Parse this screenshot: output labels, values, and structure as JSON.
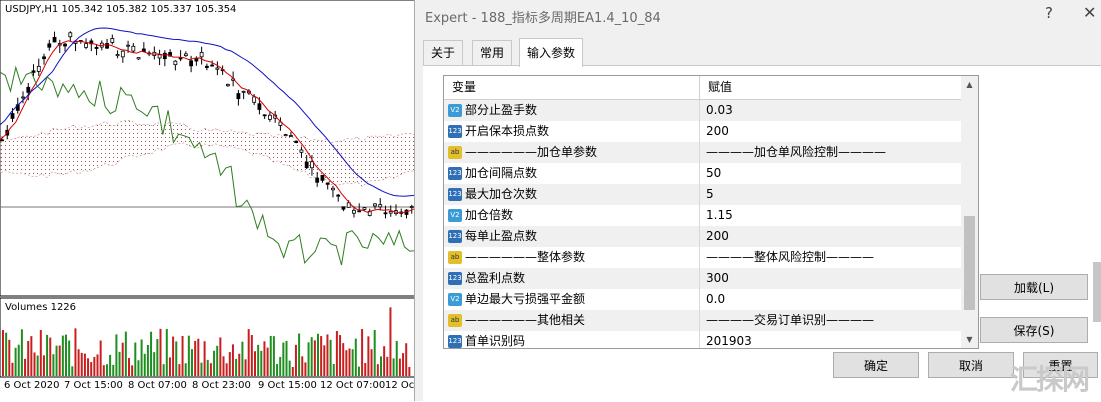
{
  "chart": {
    "symbol_label": "USDJPY,H1  105.342 105.382 105.337 105.354",
    "volumes_label": "Volumes 1226",
    "x_labels": [
      "6 Oct 2020",
      "7 Oct 15:00",
      "8 Oct 07:00",
      "8 Oct 23:00",
      "9 Oct 15:00",
      "12 Oct 07:00",
      "12 Oct"
    ]
  },
  "dialog": {
    "title": "Expert - 188_指标多周期EA1.4_10_84",
    "help_icon": "?",
    "close_icon": "✕",
    "tabs": [
      {
        "label": "关于"
      },
      {
        "label": "常用"
      },
      {
        "label": "输入参数"
      }
    ],
    "grid": {
      "headers": [
        "变量",
        "赋值"
      ],
      "rows": [
        {
          "icon": "double",
          "variable": "部分止盈手数",
          "value": "0.03"
        },
        {
          "icon": "int",
          "variable": "开启保本损点数",
          "value": "200"
        },
        {
          "icon": "string",
          "variable": "——————加仓单参数",
          "value": "————加仓单风险控制————"
        },
        {
          "icon": "int",
          "variable": "加仓间隔点数",
          "value": "50"
        },
        {
          "icon": "int",
          "variable": "最大加仓次数",
          "value": "5"
        },
        {
          "icon": "double",
          "variable": "加仓倍数",
          "value": "1.15"
        },
        {
          "icon": "int",
          "variable": "每单止盈点数",
          "value": "200"
        },
        {
          "icon": "string",
          "variable": "——————整体参数",
          "value": "————整体风险控制————"
        },
        {
          "icon": "int",
          "variable": "总盈利点数",
          "value": "300"
        },
        {
          "icon": "double",
          "variable": "单边最大亏损强平金额",
          "value": "0.0"
        },
        {
          "icon": "string",
          "variable": "——————其他相关",
          "value": "————交易订单识别————"
        },
        {
          "icon": "int",
          "variable": "首单识别码",
          "value": "201903"
        }
      ]
    },
    "buttons": {
      "load": "加载(L)",
      "save": "保存(S)",
      "ok": "确定",
      "cancel": "取消",
      "reset": "重置"
    },
    "watermark": "汇探网"
  }
}
